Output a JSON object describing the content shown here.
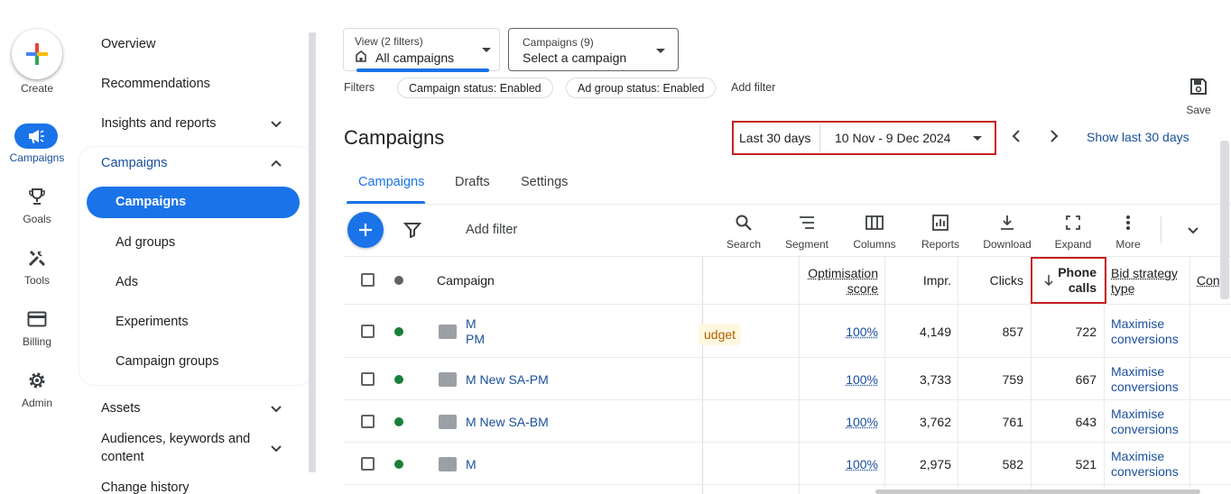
{
  "rail": {
    "create_label": "Create",
    "items": [
      {
        "label": "Campaigns",
        "icon": "megaphone-icon"
      },
      {
        "label": "Goals",
        "icon": "trophy-icon"
      },
      {
        "label": "Tools",
        "icon": "tools-icon"
      },
      {
        "label": "Billing",
        "icon": "credit-card-icon"
      },
      {
        "label": "Admin",
        "icon": "gear-icon"
      }
    ]
  },
  "nav": {
    "overview": "Overview",
    "recommendations": "Recommendations",
    "insights": "Insights and reports",
    "campaigns_group": "Campaigns",
    "campaigns_active": "Campaigns",
    "ad_groups": "Ad groups",
    "ads": "Ads",
    "experiments": "Experiments",
    "campaign_groups": "Campaign groups",
    "assets": "Assets",
    "audiences_line1": "Audiences, keywords and",
    "audiences_line2": "content",
    "change_history": "Change history"
  },
  "top": {
    "view_small": "View (2 filters)",
    "view_big": "All campaigns",
    "campaigns_small": "Campaigns (9)",
    "campaigns_big": "Select a campaign",
    "filters_label": "Filters",
    "chip1": "Campaign status: Enabled",
    "chip2": "Ad group status: Enabled",
    "add_filter": "Add filter",
    "save": "Save"
  },
  "header": {
    "title": "Campaigns",
    "date_preset": "Last 30 days",
    "date_range": "10 Nov - 9 Dec 2024",
    "show_last": "Show last 30 days"
  },
  "tabs": [
    "Campaigns",
    "Drafts",
    "Settings"
  ],
  "toolbar": {
    "add_filter": "Add filter",
    "tools": [
      "Search",
      "Segment",
      "Columns",
      "Reports",
      "Download",
      "Expand",
      "More"
    ]
  },
  "table": {
    "headers": {
      "campaign": "Campaign",
      "opt_1": "Optimisation",
      "opt_2": "score",
      "impr": "Impr.",
      "clicks": "Clicks",
      "phone_1": "Phone",
      "phone_2": "calls",
      "bid_1": "Bid strategy",
      "bid_2": "type",
      "conv": "Con"
    },
    "budget_chip": "udget",
    "rows": [
      {
        "name1": "M",
        "name2": "PM",
        "opt": "100%",
        "impr": "4,149",
        "clicks": "857",
        "calls": "722",
        "bid1": "Maximise",
        "bid2": "conversions"
      },
      {
        "name1": "M New SA-PM",
        "name2": "",
        "opt": "100%",
        "impr": "3,733",
        "clicks": "759",
        "calls": "667",
        "bid1": "Maximise",
        "bid2": "conversions"
      },
      {
        "name1": "M New SA-BM",
        "name2": "",
        "opt": "100%",
        "impr": "3,762",
        "clicks": "761",
        "calls": "643",
        "bid1": "Maximise",
        "bid2": "conversions"
      },
      {
        "name1": "M",
        "name2": "",
        "opt": "100%",
        "impr": "2,975",
        "clicks": "582",
        "calls": "521",
        "bid1": "Maximise",
        "bid2": "conversions"
      }
    ]
  },
  "colors": {
    "accent": "#1a73e8",
    "highlight_border": "#c5221f",
    "status_green": "#188038"
  }
}
